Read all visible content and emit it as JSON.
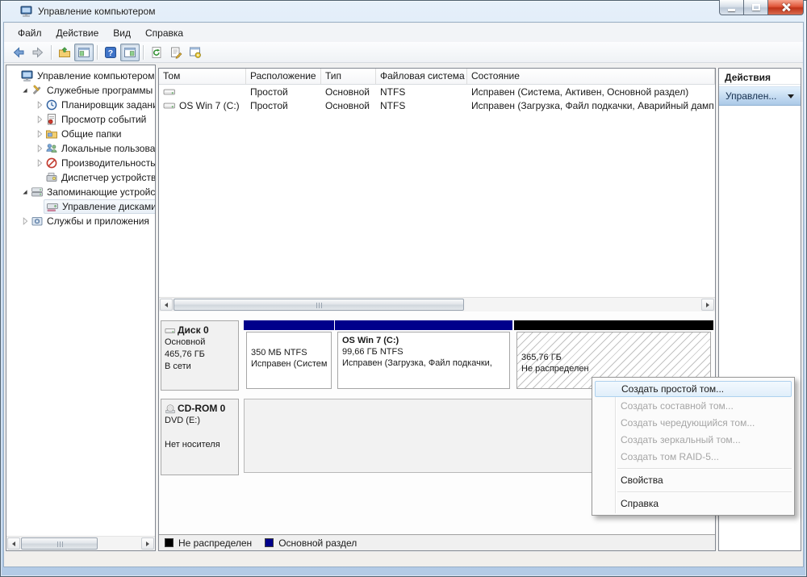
{
  "window": {
    "title": "Управление компьютером"
  },
  "menu": {
    "items": [
      "Файл",
      "Действие",
      "Вид",
      "Справка"
    ]
  },
  "toolbar": {
    "icons": [
      "back",
      "forward",
      "up-one-level",
      "show-console-tree",
      "help",
      "show-action-pane",
      "refresh",
      "properties",
      "console-settings"
    ]
  },
  "tree": {
    "items": [
      {
        "label": "Управление компьютером ("
      },
      {
        "label": "Служебные программы"
      },
      {
        "label": "Планировщик задани"
      },
      {
        "label": "Просмотр событий"
      },
      {
        "label": "Общие папки"
      },
      {
        "label": "Локальные пользова"
      },
      {
        "label": "Производительность"
      },
      {
        "label": "Диспетчер устройств"
      },
      {
        "label": "Запоминающие устройс"
      },
      {
        "label": "Управление дисками"
      },
      {
        "label": "Службы и приложения"
      }
    ]
  },
  "volumes": {
    "columns": [
      "Том",
      "Расположение",
      "Тип",
      "Файловая система",
      "Состояние"
    ],
    "rows": [
      {
        "name": "",
        "layout": "Простой",
        "type": "Основной",
        "fs": "NTFS",
        "status": "Исправен (Система, Активен, Основной раздел)"
      },
      {
        "name": "OS Win 7 (C:)",
        "layout": "Простой",
        "type": "Основной",
        "fs": "NTFS",
        "status": "Исправен (Загрузка, Файл подкачки, Аварийный дамп"
      }
    ]
  },
  "disks": {
    "disk0": {
      "name": "Диск 0",
      "kind": "Основной",
      "size": "465,76 ГБ",
      "state": "В сети",
      "partitions": [
        {
          "name": "",
          "size_fs": "350 МБ NTFS",
          "status": "Исправен (Систем",
          "band": "#00008b"
        },
        {
          "name": "OS Win 7  (C:)",
          "size_fs": "99,66 ГБ NTFS",
          "status": "Исправен (Загрузка, Файл подкачки, ",
          "band": "#00008b"
        },
        {
          "name": "",
          "size_fs": "365,76 ГБ",
          "status": "Не распределен",
          "band": "#000000",
          "unallocated": true
        }
      ]
    },
    "cdrom": {
      "name": "CD-ROM 0",
      "drive": "DVD (E:)",
      "media": "Нет носителя"
    }
  },
  "legend": {
    "items": [
      {
        "label": "Не распределен",
        "color": "#000000"
      },
      {
        "label": "Основной раздел",
        "color": "#00008b"
      }
    ]
  },
  "actions": {
    "title": "Действия",
    "section": "Управлен..."
  },
  "context_menu": {
    "items": [
      {
        "label": "Создать простой том...",
        "enabled": true,
        "highlighted": true
      },
      {
        "label": "Создать составной том...",
        "enabled": false
      },
      {
        "label": "Создать чередующийся том...",
        "enabled": false
      },
      {
        "label": "Создать зеркальный том...",
        "enabled": false
      },
      {
        "label": "Создать том RAID-5...",
        "enabled": false
      },
      {
        "label": "Свойства",
        "enabled": true
      },
      {
        "label": "Справка",
        "enabled": true
      }
    ]
  },
  "colors": {
    "primary_partition": "#00008b",
    "unallocated": "#000000",
    "menu_highlight": "#e0eefa"
  }
}
